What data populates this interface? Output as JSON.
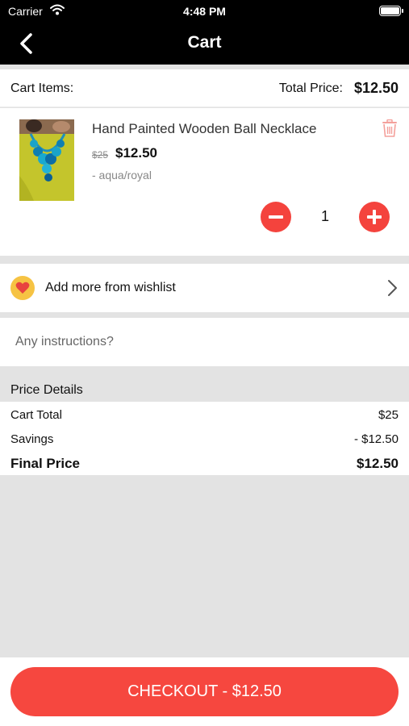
{
  "status_bar": {
    "carrier": "Carrier",
    "time": "4:48 PM"
  },
  "nav": {
    "title": "Cart",
    "back_icon": "chevron-left-icon"
  },
  "cart_header": {
    "items_label": "Cart Items:",
    "total_label": "Total Price:",
    "total_value": "$12.50"
  },
  "item": {
    "name": "Hand Painted Wooden Ball Necklace",
    "old_price": "$25",
    "price": "$12.50",
    "variant": "- aqua/royal",
    "quantity": "1"
  },
  "wishlist": {
    "label": "Add more from wishlist"
  },
  "instructions": {
    "placeholder": "Any instructions?"
  },
  "price_details": {
    "title": "Price Details",
    "cart_total_label": "Cart Total",
    "cart_total_value": "$25",
    "savings_label": "Savings",
    "savings_value": "- $12.50",
    "final_label": "Final Price",
    "final_value": "$12.50"
  },
  "checkout": {
    "label": "CHECKOUT - $12.50"
  },
  "colors": {
    "accent": "#f4433d",
    "nav_background": "#000000",
    "page_background": "#e3e3e3",
    "heart_badge": "#f6c343"
  }
}
